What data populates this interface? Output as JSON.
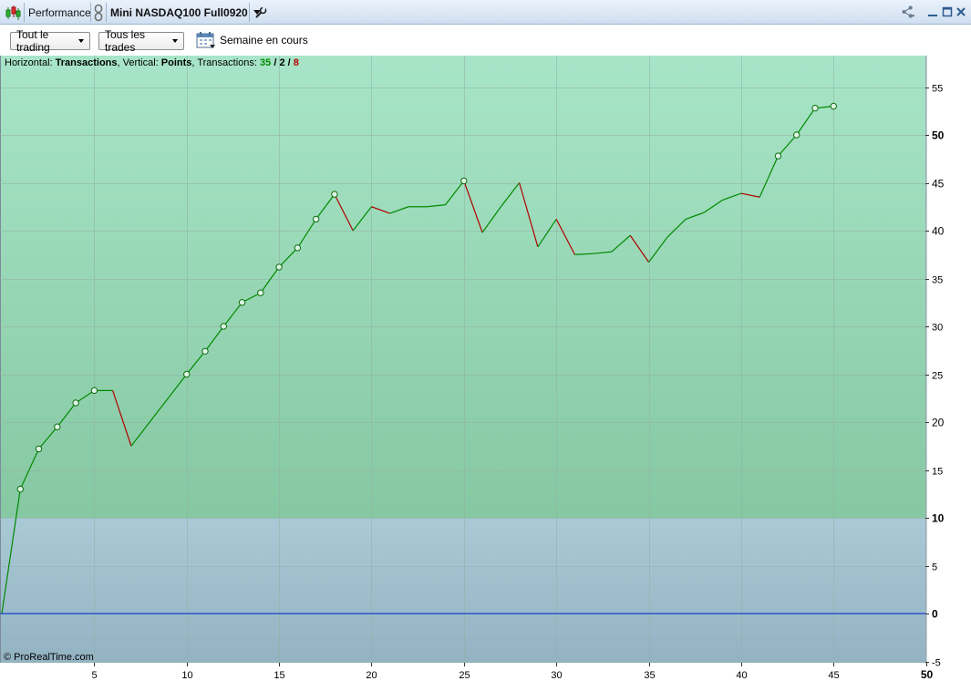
{
  "titlebar": {
    "panel_label": "Performance",
    "instrument_label": "Mini NASDAQ100 Full0920"
  },
  "toolbar": {
    "trading_filter": "Tout le trading",
    "trades_filter": "Tous les trades",
    "period_label": "Semaine en cours"
  },
  "info": {
    "h_prefix": "Horizontal: ",
    "h_value": "Transactions",
    "v_prefix": ", Vertical: ",
    "v_value": "Points",
    "t_prefix": ", Transactions: ",
    "total": "35",
    "slash1": " / ",
    "breakeven": "2",
    "slash2": " / ",
    "losers": "8"
  },
  "copyright": "© ProRealTime.com",
  "colors": {
    "win": "#008a00",
    "loss": "#b00000",
    "zero_line": "#1a3fd6",
    "upper_zone_top": "#a8e5c8",
    "upper_zone_bottom": "#86c8a2",
    "lower_zone_top": "#a9c9d6",
    "lower_zone_bottom": "#93b3c3"
  },
  "chart_data": {
    "type": "line",
    "xlabel": "",
    "ylabel": "",
    "xlim": [
      0,
      50
    ],
    "ylim": [
      -5,
      57
    ],
    "x_ticks": [
      5,
      10,
      15,
      20,
      25,
      30,
      35,
      40,
      45,
      50
    ],
    "y_ticks": [
      -5,
      0,
      5,
      10,
      15,
      20,
      25,
      30,
      35,
      40,
      45,
      50,
      55
    ],
    "zone_threshold": 10,
    "grid": true,
    "x": [
      0,
      1,
      2,
      3,
      4,
      5,
      6,
      7,
      8,
      9,
      10,
      11,
      12,
      13,
      14,
      15,
      16,
      17,
      18,
      19,
      20,
      21,
      22,
      23,
      24,
      25,
      26,
      27,
      28,
      29,
      30,
      31,
      32,
      33,
      34,
      35,
      36,
      37,
      38,
      39,
      40,
      41,
      42,
      43,
      44,
      45
    ],
    "y": [
      0,
      13,
      17.2,
      19.5,
      22,
      23.3,
      23.3,
      17.5,
      20,
      22.5,
      25,
      27.4,
      30,
      32.5,
      33.5,
      36.2,
      38.2,
      41.2,
      43.8,
      40,
      42.5,
      41.8,
      42.5,
      42.5,
      42.7,
      45.2,
      39.8,
      42.5,
      45,
      38.3,
      41.2,
      37.5,
      37.6,
      37.8,
      39.5,
      36.7,
      39.3,
      41.2,
      41.9,
      43.2,
      43.9,
      43.5,
      47.8,
      50,
      52.8,
      53
    ],
    "markers": [
      1,
      2,
      3,
      4,
      5,
      10,
      11,
      12,
      13,
      14,
      15,
      16,
      17,
      18,
      25,
      42,
      43,
      44,
      45
    ]
  }
}
